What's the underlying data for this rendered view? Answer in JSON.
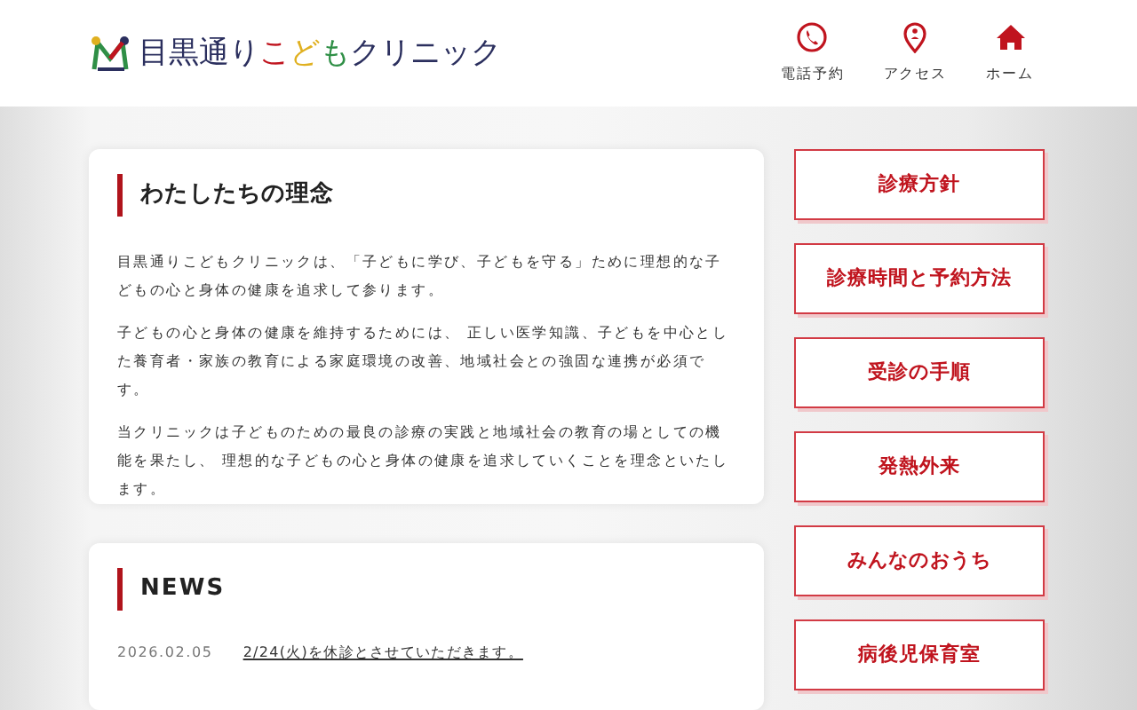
{
  "logo": {
    "parts": [
      {
        "text": "目黒通り",
        "color": "#2b2f5e"
      },
      {
        "text": "こ",
        "color": "#c0141e"
      },
      {
        "text": "ど",
        "color": "#e0b020"
      },
      {
        "text": "も",
        "color": "#2f8f46"
      },
      {
        "text": "クリニック",
        "color": "#2b2f5e"
      }
    ]
  },
  "nav": [
    {
      "label": "電話予約",
      "kind": "phone"
    },
    {
      "label": "アクセス",
      "kind": "access"
    },
    {
      "label": "ホーム",
      "kind": "home"
    }
  ],
  "philosophy": {
    "title": "わたしたちの理念",
    "paragraphs": [
      "目黒通りこどもクリニックは、「子どもに学び、子どもを守る」ために理想的な子どもの心と身体の健康を追求して参ります。",
      "子どもの心と身体の健康を維持するためには、 正しい医学知識、子どもを中心とした養育者・家族の教育による家庭環境の改善、地域社会との強固な連携が必須です。",
      "当クリニックは子どものための最良の診療の実践と地域社会の教育の場としての機能を果たし、 理想的な子どもの心と身体の健康を追求していくことを理念といたします。"
    ]
  },
  "news": {
    "title": "NEWS",
    "items": [
      {
        "date": "2026.02.05",
        "text": "2/24(火)を休診とさせていただきます。"
      }
    ]
  },
  "menu": [
    "診療方針",
    "診療時間と予約方法",
    "受診の手順",
    "発熱外来",
    "みんなのおうち",
    "病後児保育室"
  ]
}
